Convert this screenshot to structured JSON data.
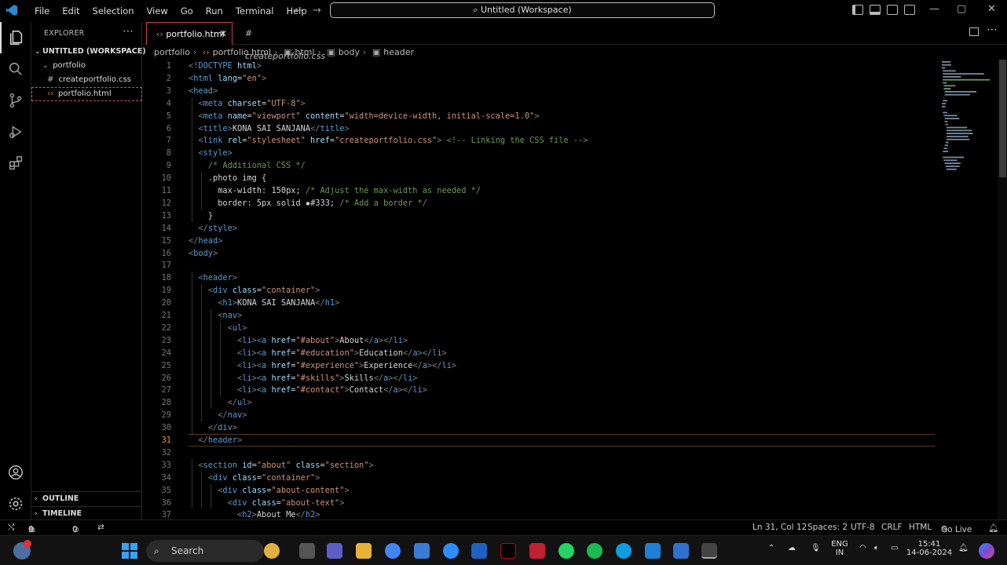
{
  "app": {
    "menu": [
      "File",
      "Edit",
      "Selection",
      "View",
      "Go",
      "Run",
      "Terminal",
      "Help"
    ],
    "command_center": "Untitled (Workspace)"
  },
  "sidebar": {
    "title": "EXPLORER",
    "workspace": "UNTITLED (WORKSPACE)",
    "folder": "portfolio",
    "files": [
      "createportfolio.css",
      "portfolio.html"
    ],
    "outline": "OUTLINE",
    "timeline": "TIMELINE"
  },
  "tabs": [
    {
      "label": "portfolio.html"
    },
    {
      "label": "createportfolio.css"
    }
  ],
  "breadcrumb": [
    "portfolio",
    "portfolio.html",
    "html",
    "body",
    "header"
  ],
  "editor": {
    "current_line": 31,
    "lines": [
      {
        "n": "1",
        "t": "<!DOCTYPE html>"
      },
      {
        "n": "2",
        "t": "<html lang=\"en\">"
      },
      {
        "n": "3",
        "t": "<head>"
      },
      {
        "n": "4",
        "t": "  <meta charset=\"UTF-8\">"
      },
      {
        "n": "5",
        "t": "  <meta name=\"viewport\" content=\"width=device-width, initial-scale=1.0\">"
      },
      {
        "n": "6",
        "t": "  <title>KONA SAI SANJANA</title>"
      },
      {
        "n": "7",
        "t": "  <link rel=\"stylesheet\" href=\"createportfolio.css\"> <!-- Linking the CSS file -->"
      },
      {
        "n": "8",
        "t": "  <style>"
      },
      {
        "n": "9",
        "t": "    /* Additional CSS */"
      },
      {
        "n": "10",
        "t": "    .photo img {"
      },
      {
        "n": "11",
        "t": "      max-width: 150px; /* Adjust the max-width as needed */"
      },
      {
        "n": "12",
        "t": "      border: 5px solid ▪#333; /* Add a border */"
      },
      {
        "n": "13",
        "t": "    }"
      },
      {
        "n": "14",
        "t": "  </style>"
      },
      {
        "n": "15",
        "t": "</head>"
      },
      {
        "n": "16",
        "t": "<body>"
      },
      {
        "n": "17",
        "t": ""
      },
      {
        "n": "18",
        "t": "  <header>"
      },
      {
        "n": "19",
        "t": "    <div class=\"container\">"
      },
      {
        "n": "20",
        "t": "      <h1>KONA SAI SANJANA</h1>"
      },
      {
        "n": "21",
        "t": "      <nav>"
      },
      {
        "n": "22",
        "t": "        <ul>"
      },
      {
        "n": "23",
        "t": "          <li><a href=\"#about\">About</a></li>"
      },
      {
        "n": "24",
        "t": "          <li><a href=\"#education\">Education</a></li>"
      },
      {
        "n": "25",
        "t": "          <li><a href=\"#experience\">Experience</a></li>"
      },
      {
        "n": "26",
        "t": "          <li><a href=\"#skills\">Skills</a></li>"
      },
      {
        "n": "27",
        "t": "          <li><a href=\"#contact\">Contact</a></li>"
      },
      {
        "n": "28",
        "t": "        </ul>"
      },
      {
        "n": "29",
        "t": "      </nav>"
      },
      {
        "n": "30",
        "t": "    </div>"
      },
      {
        "n": "31",
        "t": "  </header>"
      },
      {
        "n": "32",
        "t": ""
      },
      {
        "n": "33",
        "t": "  <section id=\"about\" class=\"section\">"
      },
      {
        "n": "34",
        "t": "    <div class=\"container\">"
      },
      {
        "n": "35",
        "t": "      <div class=\"about-content\">"
      },
      {
        "n": "36",
        "t": "        <div class=\"about-text\">"
      },
      {
        "n": "37",
        "t": "          <h2>About Me</h2>"
      }
    ]
  },
  "status": {
    "errors": "0",
    "warnings": "0",
    "ports": "0",
    "position": "Ln 31, Col 12",
    "spaces": "Spaces: 2",
    "encoding": "UTF-8",
    "eol": "CRLF",
    "language": "HTML",
    "golive": "Go Live"
  },
  "taskbar": {
    "search": "Search",
    "lang": "ENG",
    "region": "IN",
    "time": "15:41",
    "date": "14-06-2024"
  },
  "colors": {
    "tag": "#569cd6",
    "attr": "#9cdcfe",
    "string": "#ce9178",
    "comment": "#6a9955",
    "text": "#d4d4d4",
    "punct": "#808080",
    "active_tab_border": "#d04040"
  }
}
